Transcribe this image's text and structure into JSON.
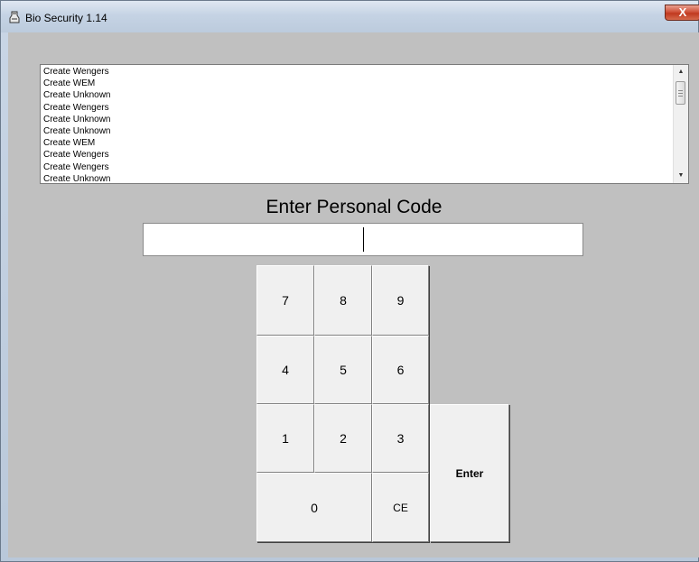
{
  "window": {
    "title": "Bio Security 1.14",
    "close_label": "X"
  },
  "log": {
    "entries": [
      "Create Wengers",
      "Create WEM",
      "Create Unknown",
      "Create Wengers",
      "Create Unknown",
      "Create Unknown",
      "Create WEM",
      "Create Wengers",
      "Create Wengers",
      "Create Unknown"
    ]
  },
  "prompt": {
    "heading": "Enter Personal Code",
    "value": ""
  },
  "keypad": {
    "k7": "7",
    "k8": "8",
    "k9": "9",
    "k4": "4",
    "k5": "5",
    "k6": "6",
    "k1": "1",
    "k2": "2",
    "k3": "3",
    "k0": "0",
    "ce": "CE",
    "enter": "Enter"
  }
}
